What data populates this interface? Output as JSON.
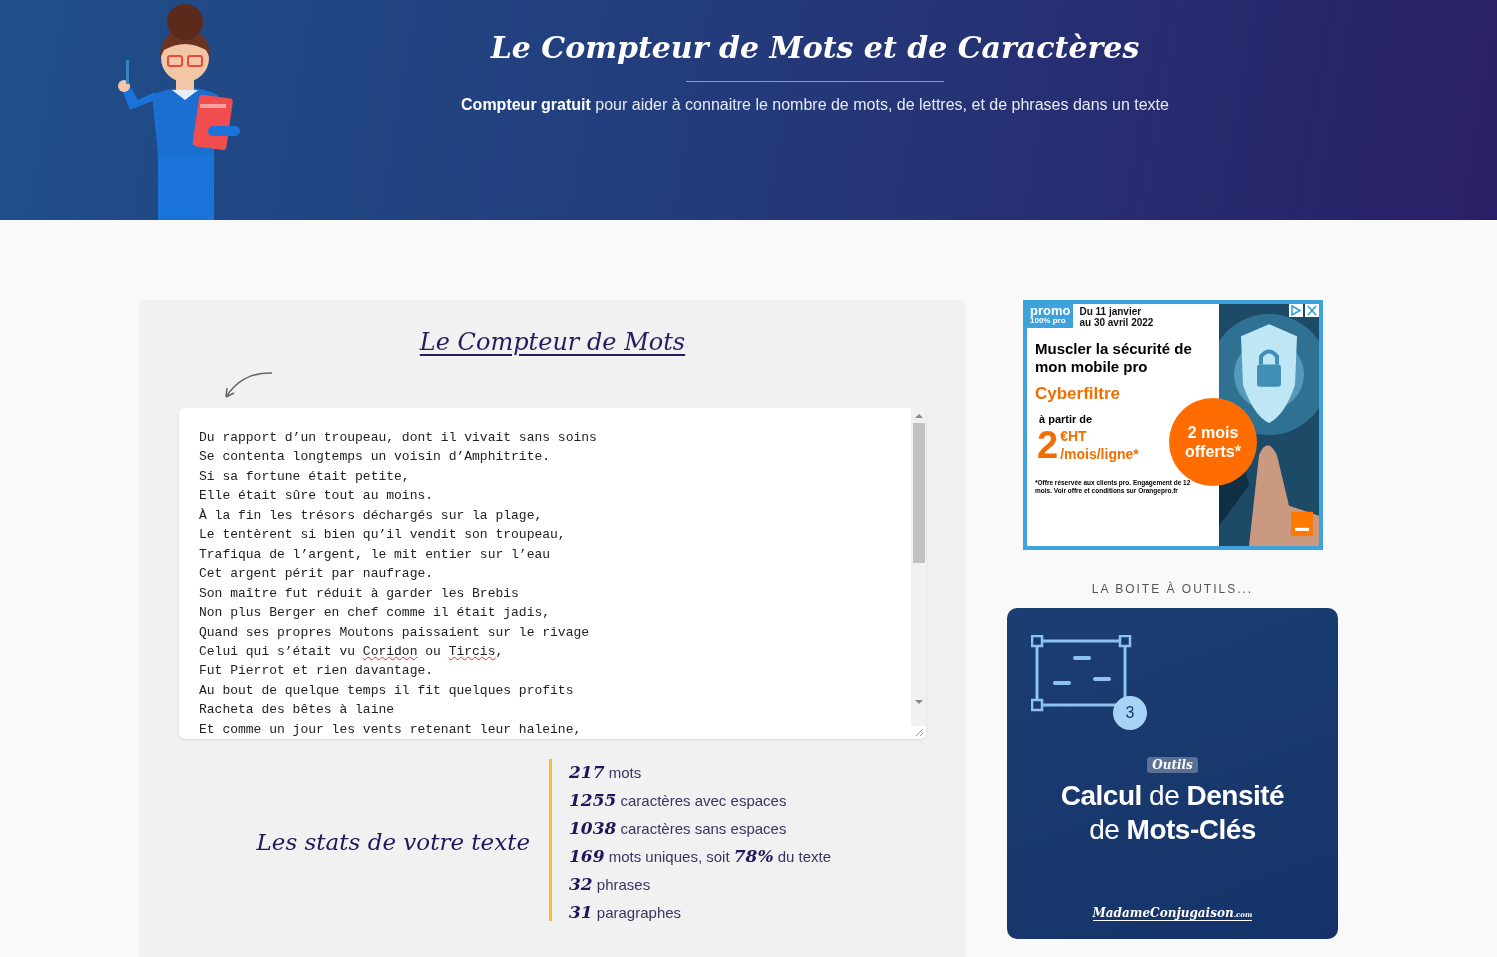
{
  "header": {
    "title": "Le Compteur de Mots et de Caractères",
    "subtitle": "**Compteur gratuit** pour aider à connaitre le nombre de mots, de lettres, et de phrases dans un texte"
  },
  "counter": {
    "title": "Le Compteur de Mots",
    "lines": [
      [
        {
          "text": "Du rapport d’un troupeau, dont il vivait sans soins",
          "misspelled": false
        }
      ],
      [
        {
          "text": "Se contenta longtemps un voisin d’Amphitrite.",
          "misspelled": false
        }
      ],
      [
        {
          "text": "Si sa fortune était petite,",
          "misspelled": false
        }
      ],
      [
        {
          "text": "Elle était sûre tout au moins.",
          "misspelled": false
        }
      ],
      [
        {
          "text": "À la fin les trésors déchargés sur la plage,",
          "misspelled": false
        }
      ],
      [
        {
          "text": "Le tentèrent si bien qu’il vendit son troupeau,",
          "misspelled": false
        }
      ],
      [
        {
          "text": "Trafiqua de l’argent, le mit entier sur l’eau",
          "misspelled": false
        }
      ],
      [
        {
          "text": "Cet argent périt par naufrage.",
          "misspelled": false
        }
      ],
      [
        {
          "text": "Son maître fut réduit à garder les Brebis",
          "misspelled": false
        }
      ],
      [
        {
          "text": "Non plus Berger en chef comme il était jadis,",
          "misspelled": false
        }
      ],
      [
        {
          "text": "Quand ses propres Moutons paissaient sur le rivage",
          "misspelled": false
        }
      ],
      [
        {
          "text": "Celui qui s’était vu ",
          "misspelled": false
        },
        {
          "text": "Coridon",
          "misspelled": true
        },
        {
          "text": " ou ",
          "misspelled": false
        },
        {
          "text": "Tircis",
          "misspelled": true
        },
        {
          "text": ",",
          "misspelled": false
        }
      ],
      [
        {
          "text": "Fut Pierrot et rien davantage.",
          "misspelled": false
        }
      ],
      [
        {
          "text": "Au bout de quelque temps il fit quelques profits",
          "misspelled": false
        }
      ],
      [
        {
          "text": "Racheta des bêtes à laine",
          "misspelled": false
        }
      ],
      [
        {
          "text": "Et comme un jour les vents retenant leur haleine,",
          "misspelled": false
        }
      ]
    ],
    "stats_title": "Les stats de votre texte",
    "stats": [
      "**217** mots",
      "**1255** caractères avec espaces",
      "**1038** caractères sans espaces",
      "**169** mots uniques, soit **78%** du texte",
      "**32** phrases",
      "**31** paragraphes"
    ]
  },
  "ad": {
    "promo": "promo",
    "promo_sub": "100% pro",
    "dates": [
      "Du 11 janvier",
      "au 30 avril 2022"
    ],
    "headline": "Muscler la sécurité de mon mobile pro",
    "product": "Cyberfiltre",
    "from": "à partir de",
    "price": "2",
    "price_unit": "€HT",
    "price_period": "/mois/ligne*",
    "offer": "2 mois offerts*",
    "footnote": "*Offre réservée aux clients pro. Engagement de 12 mois. Voir offre et conditions sur Orangepro.fr"
  },
  "toolbox": {
    "heading": "LA BOITE À OUTILS...",
    "badge": "3",
    "tag": "Outils",
    "title": "**Calcul** de **Densité** de **Mots-Clés**",
    "brand": "MadameConjugaison",
    "brand_suffix": ".com"
  }
}
